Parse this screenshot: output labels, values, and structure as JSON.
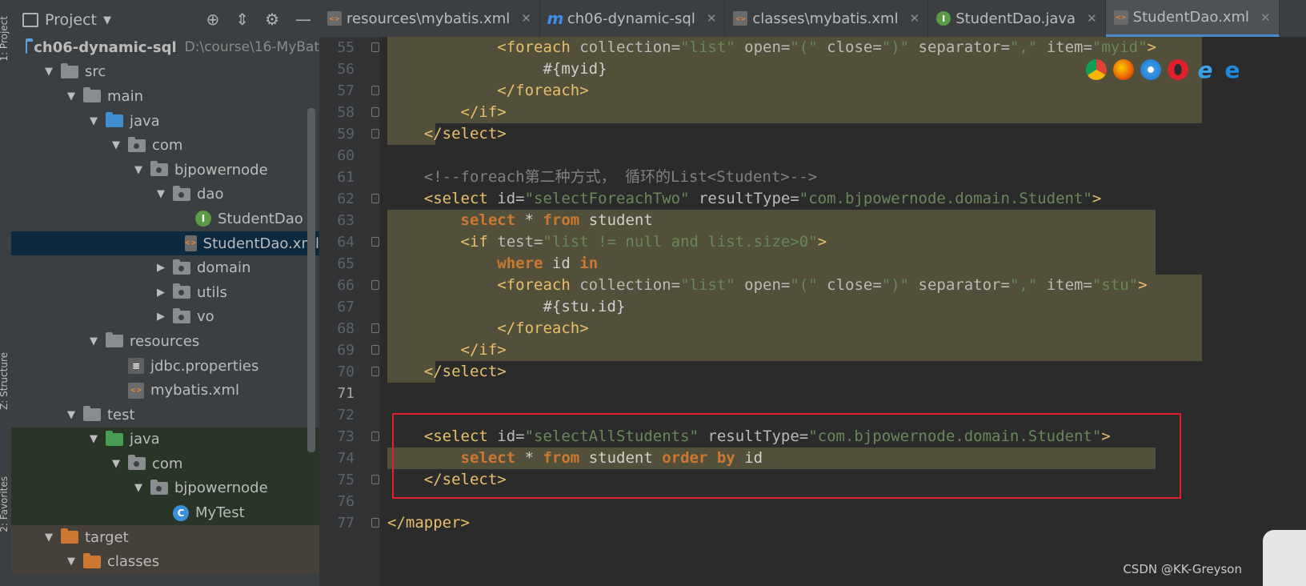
{
  "side_strip": [
    "1: Project",
    "Z: Structure",
    "2: Favorites"
  ],
  "project_panel": {
    "title": "Project"
  },
  "tree": [
    {
      "label": "ch06-dynamic-sql",
      "path": "D:\\course\\16-MyBat",
      "icon": "module-icon",
      "depth": 0,
      "arrow": ""
    },
    {
      "label": "src",
      "icon": "folder-icon",
      "depth": 1,
      "arrow": "▼"
    },
    {
      "label": "main",
      "icon": "folder-icon",
      "depth": 2,
      "arrow": "▼"
    },
    {
      "label": "java",
      "icon": "source-folder-icon",
      "depth": 3,
      "arrow": "▼"
    },
    {
      "label": "com",
      "icon": "package-icon",
      "depth": 4,
      "arrow": "▼"
    },
    {
      "label": "bjpowernode",
      "icon": "package-icon",
      "depth": 5,
      "arrow": "▼"
    },
    {
      "label": "dao",
      "icon": "package-icon",
      "depth": 6,
      "arrow": "▼"
    },
    {
      "label": "StudentDao",
      "icon": "interface-icon",
      "depth": 7,
      "arrow": ""
    },
    {
      "label": "StudentDao.xml",
      "icon": "xml-file-icon",
      "depth": 7,
      "arrow": "",
      "selected": true
    },
    {
      "label": "domain",
      "icon": "package-icon",
      "depth": 6,
      "arrow": "▶"
    },
    {
      "label": "utils",
      "icon": "package-icon",
      "depth": 6,
      "arrow": "▶"
    },
    {
      "label": "vo",
      "icon": "package-icon",
      "depth": 6,
      "arrow": "▶"
    },
    {
      "label": "resources",
      "icon": "resources-folder-icon",
      "depth": 3,
      "arrow": "▼"
    },
    {
      "label": "jdbc.properties",
      "icon": "properties-file-icon",
      "depth": 4,
      "arrow": ""
    },
    {
      "label": "mybatis.xml",
      "icon": "xml-file-icon",
      "depth": 4,
      "arrow": ""
    },
    {
      "label": "test",
      "icon": "folder-icon",
      "depth": 2,
      "arrow": "▼"
    },
    {
      "label": "java",
      "icon": "test-folder-icon",
      "depth": 3,
      "arrow": "▼",
      "bg": "test"
    },
    {
      "label": "com",
      "icon": "package-icon",
      "depth": 4,
      "arrow": "▼",
      "bg": "test"
    },
    {
      "label": "bjpowernode",
      "icon": "package-icon",
      "depth": 5,
      "arrow": "▼",
      "bg": "test"
    },
    {
      "label": "MyTest",
      "icon": "class-icon",
      "depth": 6,
      "arrow": "",
      "bg": "test"
    },
    {
      "label": "target",
      "icon": "excluded-folder-icon",
      "depth": 1,
      "arrow": "▼",
      "bg": "target"
    },
    {
      "label": "classes",
      "icon": "excluded-folder-icon",
      "depth": 2,
      "arrow": "▼",
      "bg": "target"
    }
  ],
  "tabs": [
    {
      "label": "resources\\mybatis.xml",
      "icon": "xml"
    },
    {
      "label": "ch06-dynamic-sql",
      "icon": "m"
    },
    {
      "label": "classes\\mybatis.xml",
      "icon": "xml"
    },
    {
      "label": "StudentDao.java",
      "icon": "iface"
    },
    {
      "label": "StudentDao.xml",
      "icon": "xml",
      "active": true
    }
  ],
  "code_lines": [
    {
      "n": "55",
      "html_parts": [
        [
          "t",
          "            "
        ],
        [
          "tag",
          "<foreach "
        ],
        [
          "attr",
          "collection="
        ],
        [
          "val",
          "\"list\""
        ],
        [
          "attr",
          " open="
        ],
        [
          "val",
          "\"(\""
        ],
        [
          "attr",
          " close="
        ],
        [
          "val",
          "\")\""
        ],
        [
          "attr",
          " separator="
        ],
        [
          "val",
          "\",\""
        ],
        [
          "attr",
          " item="
        ],
        [
          "val",
          "\"myid\""
        ],
        [
          "tag",
          ">"
        ]
      ],
      "hl": true
    },
    {
      "n": "56",
      "html_parts": [
        [
          "t",
          "                 #{myid}"
        ]
      ],
      "hl": true
    },
    {
      "n": "57",
      "html_parts": [
        [
          "t",
          "            "
        ],
        [
          "tag",
          "</foreach>"
        ]
      ],
      "hl": true
    },
    {
      "n": "58",
      "html_parts": [
        [
          "t",
          "        "
        ],
        [
          "tag",
          "</if>"
        ]
      ],
      "hl": true
    },
    {
      "n": "59",
      "html_parts": [
        [
          "t",
          "    "
        ],
        [
          "tag",
          "</select>"
        ]
      ],
      "hl": true
    },
    {
      "n": "60",
      "html_parts": [
        [
          "t",
          ""
        ]
      ]
    },
    {
      "n": "61",
      "html_parts": [
        [
          "t",
          "    "
        ],
        [
          "cmt",
          "<!--foreach第二种方式， 循环的List<Student>-->"
        ]
      ]
    },
    {
      "n": "62",
      "html_parts": [
        [
          "t",
          "    "
        ],
        [
          "tag",
          "<select "
        ],
        [
          "attr",
          "id="
        ],
        [
          "val",
          "\"selectForeachTwo\""
        ],
        [
          "attr",
          " resultType="
        ],
        [
          "val",
          "\"com.bjpowernode.domain.Student\""
        ],
        [
          "tag",
          ">"
        ]
      ]
    },
    {
      "n": "63",
      "html_parts": [
        [
          "t",
          "        "
        ],
        [
          "kw",
          "select"
        ],
        [
          "t",
          " * "
        ],
        [
          "kw",
          "from"
        ],
        [
          "t",
          " student"
        ]
      ],
      "hl": true
    },
    {
      "n": "64",
      "html_parts": [
        [
          "t",
          "        "
        ],
        [
          "tag",
          "<if "
        ],
        [
          "attr",
          "test="
        ],
        [
          "val",
          "\"list != null and list.size>0\""
        ],
        [
          "tag",
          ">"
        ]
      ],
      "hl": true
    },
    {
      "n": "65",
      "html_parts": [
        [
          "t",
          "            "
        ],
        [
          "kw",
          "where"
        ],
        [
          "t",
          " id "
        ],
        [
          "kw",
          "in"
        ]
      ],
      "hl": true
    },
    {
      "n": "66",
      "html_parts": [
        [
          "t",
          "            "
        ],
        [
          "tag",
          "<foreach "
        ],
        [
          "attr",
          "collection="
        ],
        [
          "val",
          "\"list\""
        ],
        [
          "attr",
          " open="
        ],
        [
          "val",
          "\"(\""
        ],
        [
          "attr",
          " close="
        ],
        [
          "val",
          "\")\""
        ],
        [
          "attr",
          " separator="
        ],
        [
          "val",
          "\",\""
        ],
        [
          "attr",
          " item="
        ],
        [
          "val",
          "\"stu\""
        ],
        [
          "tag",
          ">"
        ]
      ],
      "hl": true
    },
    {
      "n": "67",
      "html_parts": [
        [
          "t",
          "                 #{stu.id}"
        ]
      ],
      "hl": true
    },
    {
      "n": "68",
      "html_parts": [
        [
          "t",
          "            "
        ],
        [
          "tag",
          "</foreach>"
        ]
      ],
      "hl": true
    },
    {
      "n": "69",
      "html_parts": [
        [
          "t",
          "        "
        ],
        [
          "tag",
          "</if>"
        ]
      ],
      "hl": true
    },
    {
      "n": "70",
      "html_parts": [
        [
          "t",
          "    "
        ],
        [
          "tag",
          "</select>"
        ]
      ],
      "hl": true
    },
    {
      "n": "71",
      "html_parts": [
        [
          "t",
          ""
        ]
      ]
    },
    {
      "n": "72",
      "html_parts": [
        [
          "t",
          ""
        ]
      ]
    },
    {
      "n": "73",
      "html_parts": [
        [
          "t",
          "    "
        ],
        [
          "tag",
          "<select "
        ],
        [
          "attr",
          "id="
        ],
        [
          "val",
          "\"selectAllStudents\""
        ],
        [
          "attr",
          " resultType="
        ],
        [
          "val",
          "\"com.bjpowernode.domain.Student\""
        ],
        [
          "tag",
          ">"
        ]
      ]
    },
    {
      "n": "74",
      "html_parts": [
        [
          "t",
          "        "
        ],
        [
          "kw",
          "select"
        ],
        [
          "t",
          " * "
        ],
        [
          "kw",
          "from"
        ],
        [
          "t",
          " student "
        ],
        [
          "kw",
          "order by"
        ],
        [
          "t",
          " id"
        ]
      ],
      "hl": true
    },
    {
      "n": "75",
      "html_parts": [
        [
          "t",
          "    "
        ],
        [
          "tag",
          "</select>"
        ]
      ]
    },
    {
      "n": "76",
      "html_parts": [
        [
          "t",
          ""
        ]
      ]
    },
    {
      "n": "77",
      "html_parts": [
        [
          "tag",
          "</mapper>"
        ]
      ]
    }
  ],
  "watermark": "CSDN @KK-Greyson",
  "colors": {
    "selection": "#0d293e",
    "highlight_box": "#e0202a",
    "hl_bg": "#52503a"
  }
}
